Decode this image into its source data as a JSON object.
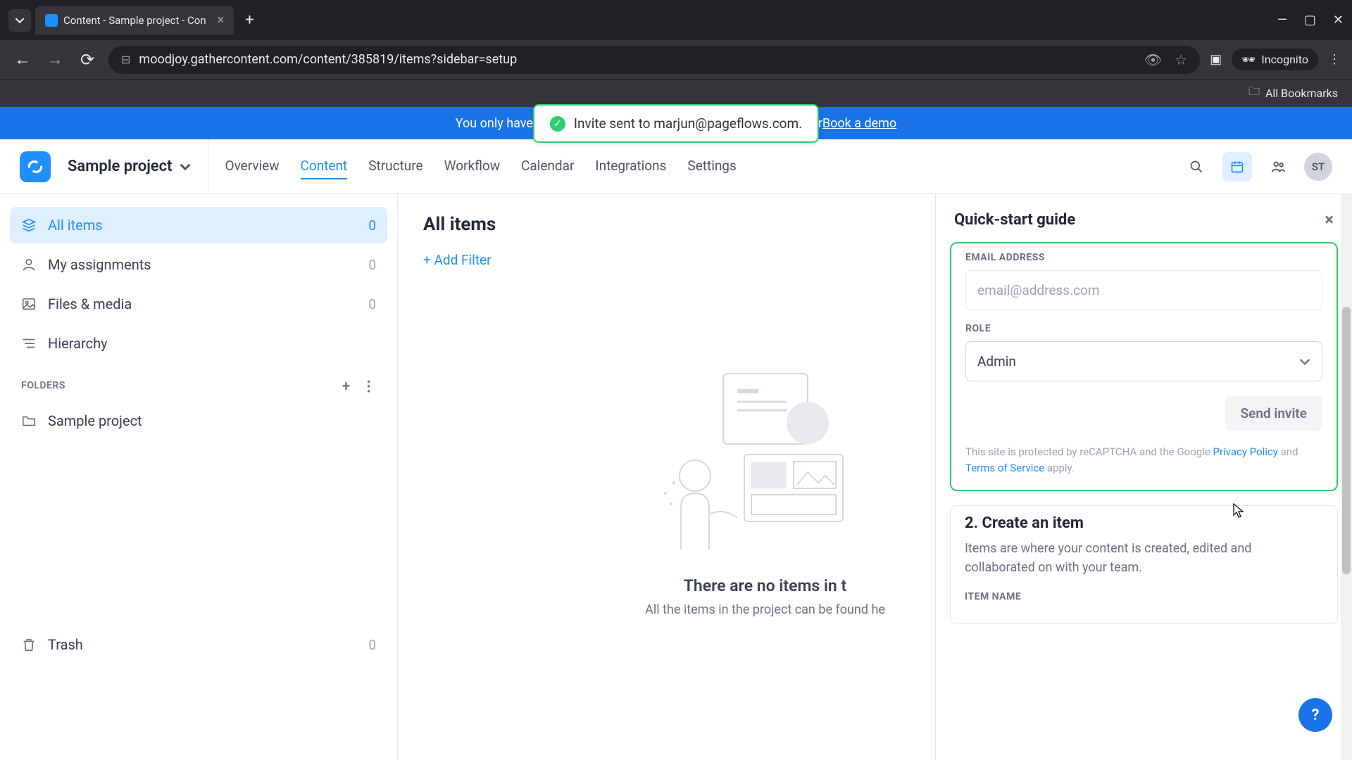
{
  "browser": {
    "tab_title": "Content - Sample project - Con",
    "url": "moodjoy.gathercontent.com/content/385819/items?sidebar=setup",
    "incognito_label": "Incognito",
    "bookmarks_label": "All Bookmarks"
  },
  "banner": {
    "text_prefix": "You only have 1",
    "text_suffix": " or ",
    "demo_link": "Book a demo"
  },
  "toast": {
    "message": "Invite sent to marjun@pageflows.com."
  },
  "header": {
    "project_name": "Sample project",
    "nav": [
      "Overview",
      "Content",
      "Structure",
      "Workflow",
      "Calendar",
      "Integrations",
      "Settings"
    ],
    "active_nav": "Content",
    "avatar": "ST"
  },
  "sidebar": {
    "items": [
      {
        "label": "All items",
        "count": "0",
        "active": true
      },
      {
        "label": "My assignments",
        "count": "0",
        "active": false
      },
      {
        "label": "Files & media",
        "count": "0",
        "active": false
      },
      {
        "label": "Hierarchy",
        "count": "",
        "active": false
      }
    ],
    "folders_label": "FOLDERS",
    "folders": [
      {
        "label": "Sample project"
      }
    ],
    "trash": {
      "label": "Trash",
      "count": "0"
    }
  },
  "main": {
    "title": "All items",
    "add_filter": "+ Add Filter",
    "empty_title": "There are no items in t",
    "empty_sub": "All the items in the project can be found he"
  },
  "quick": {
    "title": "Quick-start guide",
    "email_label": "EMAIL ADDRESS",
    "email_placeholder": "email@address.com",
    "role_label": "ROLE",
    "role_selected": "Admin",
    "send_button": "Send invite",
    "recaptcha_prefix": "This site is protected by reCAPTCHA and the Google ",
    "privacy": "Privacy Policy",
    "recaptcha_and": " and ",
    "tos": "Terms of Service",
    "recaptcha_suffix": " apply.",
    "step2_title": "2. Create an item",
    "step2_desc": "Items are where your content is created, edited and collaborated on with your team.",
    "step2_field": "ITEM NAME"
  }
}
